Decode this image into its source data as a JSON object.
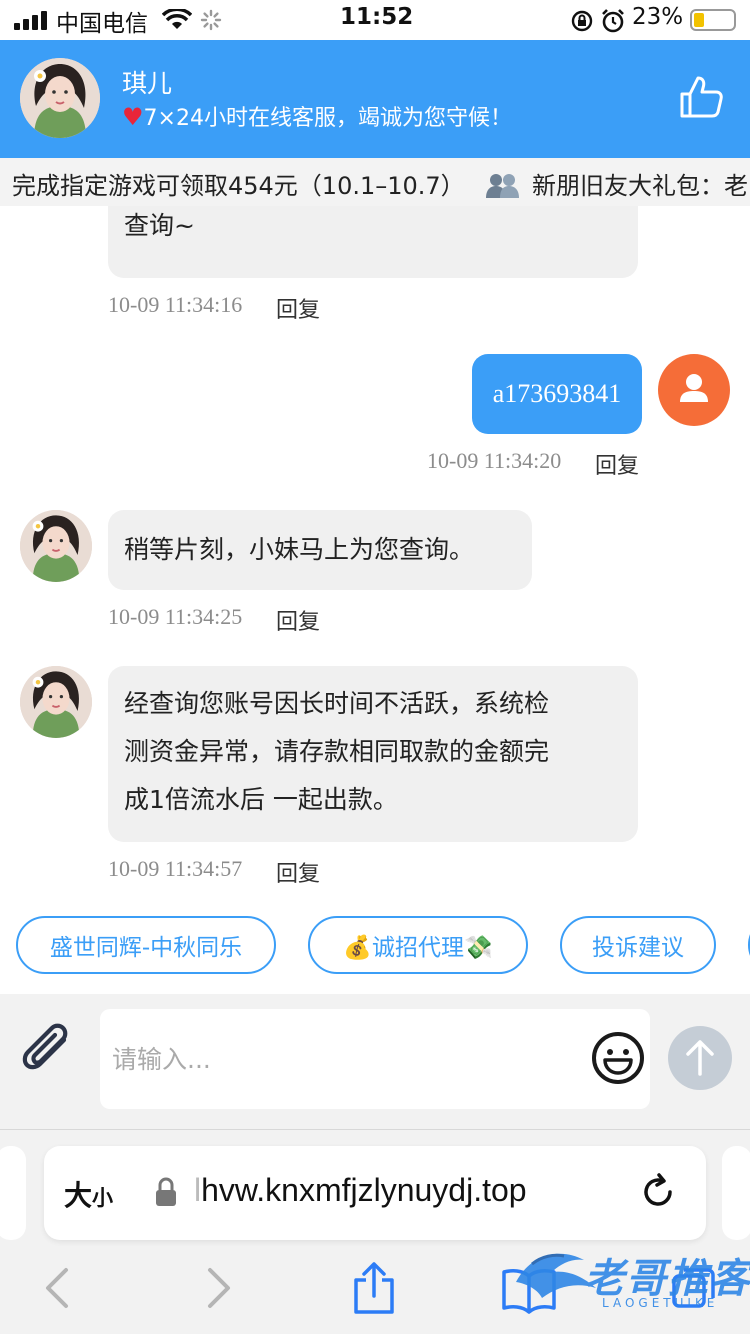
{
  "status_bar": {
    "carrier": "中国电信",
    "time": "11:52",
    "battery": "23%"
  },
  "header": {
    "agent_name": "琪儿",
    "agent_tagline": "7×24小时在线客服，竭诚为您守候！",
    "icons": [
      "agent-avatar",
      "heart-icon",
      "thumbs-up-icon"
    ]
  },
  "ticker": {
    "item1": "完成指定游戏可领取454元（10.1–10.7）",
    "item2": "新朋旧友大礼包：老"
  },
  "chat": {
    "reply_label": "回复",
    "messages": [
      {
        "sender": "agent",
        "text": "查询~",
        "time": "10-09 11:34:16"
      },
      {
        "sender": "user",
        "text": "a173693841",
        "time": "10-09 11:34:20"
      },
      {
        "sender": "agent",
        "text": "稍等片刻，小妹马上为您查询。",
        "time": "10-09 11:34:25"
      },
      {
        "sender": "agent",
        "lines": [
          "经查询您账号因长时间不活跃，系统检",
          "测资金异常，请存款相同取款的金额完",
          "成1倍流水后 一起出款。"
        ],
        "time": "10-09 11:34:57"
      }
    ]
  },
  "quick_replies": [
    "盛世同辉-中秋同乐",
    "💰诚招代理💸",
    "投诉建议"
  ],
  "composer": {
    "placeholder": "请输入..."
  },
  "browser": {
    "text_size": "大",
    "text_size_small": "小",
    "url_prefix": "l",
    "url": "hvw.knxmfjzlynuydj.top"
  },
  "watermark": {
    "text": "老哥推客",
    "sub": "LAOGETUIKE"
  },
  "colors": {
    "accent": "#3b9ef7",
    "user_avatar": "#f56d38",
    "bubble_bg": "#f0f0f0"
  }
}
